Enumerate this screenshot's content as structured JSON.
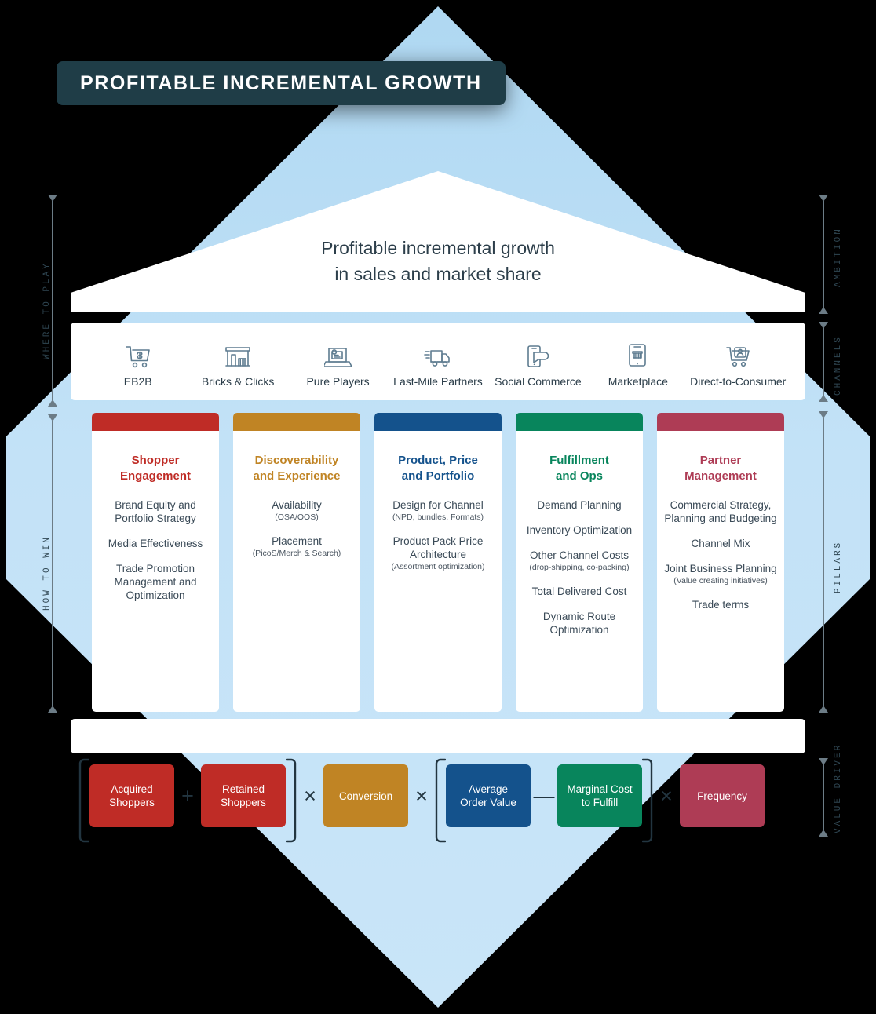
{
  "title": "PROFITABLE INCREMENTAL GROWTH",
  "ambition": {
    "line1": "Profitable incremental growth",
    "line2": "in sales and market share"
  },
  "axes": {
    "left": [
      {
        "label": "WHERE TO PLAY"
      },
      {
        "label": "HOW TO WIN"
      }
    ],
    "right": [
      {
        "label": "AMBITION"
      },
      {
        "label": "CHANNELS"
      },
      {
        "label": "PILLARS"
      },
      {
        "label": "VALUE DRIVER"
      }
    ]
  },
  "channels": [
    {
      "label": "EB2B",
      "icon": "shopping-cart-dollar-icon"
    },
    {
      "label": "Bricks & Clicks",
      "icon": "storefront-icon"
    },
    {
      "label": "Pure Players",
      "icon": "laptop-payment-icon"
    },
    {
      "label": "Last-Mile Partners",
      "icon": "delivery-truck-icon"
    },
    {
      "label": "Social Commerce",
      "icon": "phone-chat-icon"
    },
    {
      "label": "Marketplace",
      "icon": "phone-storefront-icon"
    },
    {
      "label": "Direct-to-Consumer",
      "icon": "shopping-cart-person-icon"
    }
  ],
  "pillars": [
    {
      "title": "Shopper\nEngagement",
      "color": "#BF2C26",
      "items": [
        {
          "text": "Brand Equity and Portfolio Strategy",
          "sub": ""
        },
        {
          "text": "Media Effectiveness",
          "sub": ""
        },
        {
          "text": "Trade Promotion Management and Optimization",
          "sub": ""
        }
      ]
    },
    {
      "title": "Discoverability\nand Experience",
      "color": "#C08424",
      "items": [
        {
          "text": "Availability",
          "sub": "(OSA/OOS)"
        },
        {
          "text": "Placement",
          "sub": "(PicoS/Merch & Search)"
        }
      ]
    },
    {
      "title": "Product, Price\nand Portfolio",
      "color": "#14528C",
      "items": [
        {
          "text": "Design for Channel",
          "sub": "(NPD, bundles, Formats)"
        },
        {
          "text": "Product Pack Price Architecture",
          "sub": "(Assortment optimization)"
        }
      ]
    },
    {
      "title": "Fulfillment\nand Ops",
      "color": "#08855C",
      "items": [
        {
          "text": "Demand Planning",
          "sub": ""
        },
        {
          "text": "Inventory Optimization",
          "sub": ""
        },
        {
          "text": "Other Channel Costs",
          "sub": "(drop-shipping, co-packing)"
        },
        {
          "text": "Total Delivered Cost",
          "sub": ""
        },
        {
          "text": "Dynamic Route Optimization",
          "sub": ""
        }
      ]
    },
    {
      "title": "Partner\nManagement",
      "color": "#AE3C55",
      "items": [
        {
          "text": "Commercial Strategy, Planning and Budgeting",
          "sub": ""
        },
        {
          "text": "Channel Mix",
          "sub": ""
        },
        {
          "text": "Joint Business Planning",
          "sub": "(Value creating initiatives)"
        },
        {
          "text": "Trade terms",
          "sub": ""
        }
      ]
    }
  ],
  "equation": {
    "group1": {
      "boxes": [
        {
          "label": "Acquired\nShoppers",
          "color": "#BF2C26"
        },
        {
          "label": "Retained\nShoppers",
          "color": "#BF2C26"
        }
      ],
      "inner_op": "+"
    },
    "op1": "×",
    "box_conversion": {
      "label": "Conversion",
      "color": "#C08424"
    },
    "op2": "×",
    "group2": {
      "boxes": [
        {
          "label": "Average\nOrder Value",
          "color": "#14528C"
        },
        {
          "label": "Marginal Cost\nto Fulfill",
          "color": "#08855C"
        }
      ],
      "inner_op": "—"
    },
    "op3": "×",
    "box_frequency": {
      "label": "Frequency",
      "color": "#AE3C55"
    }
  },
  "colors": {
    "background": "#000000",
    "hexagon": "#BFDFF5",
    "panel": "#FFFFFF",
    "title_badge": "#1F3D47",
    "text_dark": "#2C3E4A",
    "icon_stroke": "#5E7C90",
    "axis": "#6C7C86"
  }
}
